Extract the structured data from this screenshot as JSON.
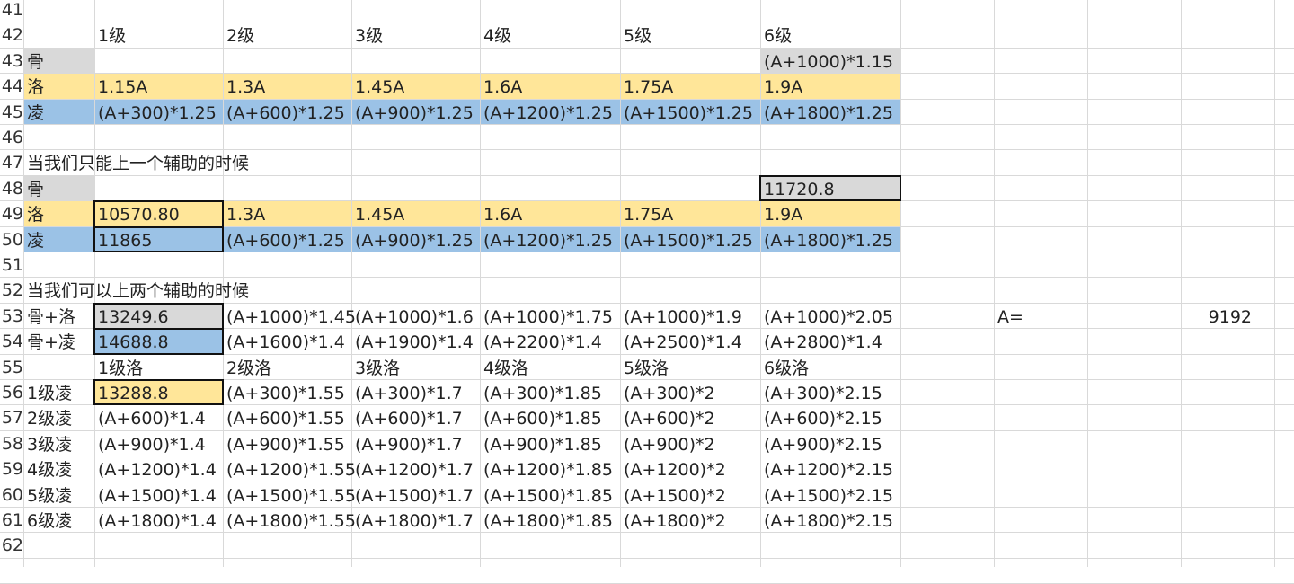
{
  "colors": {
    "gray": "#d9d9d9",
    "yellow": "#ffe699",
    "blue": "#9bc2e6"
  },
  "row_numbers": [
    "41",
    "42",
    "43",
    "44",
    "45",
    "46",
    "47",
    "48",
    "49",
    "50",
    "51",
    "52",
    "53",
    "54",
    "55",
    "56",
    "57",
    "58",
    "59",
    "60",
    "61",
    "62"
  ],
  "rows": {
    "r42": [
      "",
      "1级",
      "2级",
      "3级",
      "4级",
      "5级",
      "6级"
    ],
    "r43": [
      "骨",
      "",
      "",
      "",
      "",
      "",
      "(A+1000)*1.15"
    ],
    "r44": [
      "洛",
      "1.15A",
      "1.3A",
      "1.45A",
      "1.6A",
      "1.75A",
      "1.9A"
    ],
    "r45": [
      "凌",
      "(A+300)*1.25",
      "(A+600)*1.25",
      "(A+900)*1.25",
      "(A+1200)*1.25",
      "(A+1500)*1.25",
      "(A+1800)*1.25"
    ],
    "r47": [
      "当我们只能上一个辅助的时候"
    ],
    "r48": [
      "骨",
      "",
      "",
      "",
      "",
      "",
      "11720.8"
    ],
    "r49": [
      "洛",
      "10570.80",
      "1.3A",
      "1.45A",
      "1.6A",
      "1.75A",
      "1.9A"
    ],
    "r50": [
      "凌",
      "11865",
      "(A+600)*1.25",
      "(A+900)*1.25",
      "(A+1200)*1.25",
      "(A+1500)*1.25",
      "(A+1800)*1.25"
    ],
    "r52": [
      "当我们可以上两个辅助的时候"
    ],
    "r53": [
      "骨+洛",
      "13249.6",
      "(A+1000)*1.45",
      "(A+1000)*1.6",
      "(A+1000)*1.75",
      "(A+1000)*1.9",
      "(A+1000)*2.05"
    ],
    "r54": [
      "骨+凌",
      "14688.8",
      "(A+1600)*1.4",
      "(A+1900)*1.4",
      "(A+2200)*1.4",
      "(A+2500)*1.4",
      "(A+2800)*1.4"
    ],
    "r55": [
      "",
      "1级洛",
      "2级洛",
      "3级洛",
      "4级洛",
      "5级洛",
      "6级洛"
    ],
    "r56": [
      "1级凌",
      "13288.8",
      "(A+300)*1.55",
      "(A+300)*1.7",
      "(A+300)*1.85",
      "(A+300)*2",
      "(A+300)*2.15"
    ],
    "r57": [
      "2级凌",
      "(A+600)*1.4",
      "(A+600)*1.55",
      "(A+600)*1.7",
      "(A+600)*1.85",
      "(A+600)*2",
      "(A+600)*2.15"
    ],
    "r58": [
      "3级凌",
      "(A+900)*1.4",
      "(A+900)*1.55",
      "(A+900)*1.7",
      "(A+900)*1.85",
      "(A+900)*2",
      "(A+900)*2.15"
    ],
    "r59": [
      "4级凌",
      "(A+1200)*1.4",
      "(A+1200)*1.55",
      "(A+1200)*1.7",
      "(A+1200)*1.85",
      "(A+1200)*2",
      "(A+1200)*2.15"
    ],
    "r60": [
      "5级凌",
      "(A+1500)*1.4",
      "(A+1500)*1.55",
      "(A+1500)*1.7",
      "(A+1500)*1.85",
      "(A+1500)*2",
      "(A+1500)*2.15"
    ],
    "r61": [
      "6级凌",
      "(A+1800)*1.4",
      "(A+1800)*1.55",
      "(A+1800)*1.7",
      "(A+1800)*1.85",
      "(A+1800)*2",
      "(A+1800)*2.15"
    ]
  },
  "side": {
    "label": "A=",
    "value": "9192"
  }
}
